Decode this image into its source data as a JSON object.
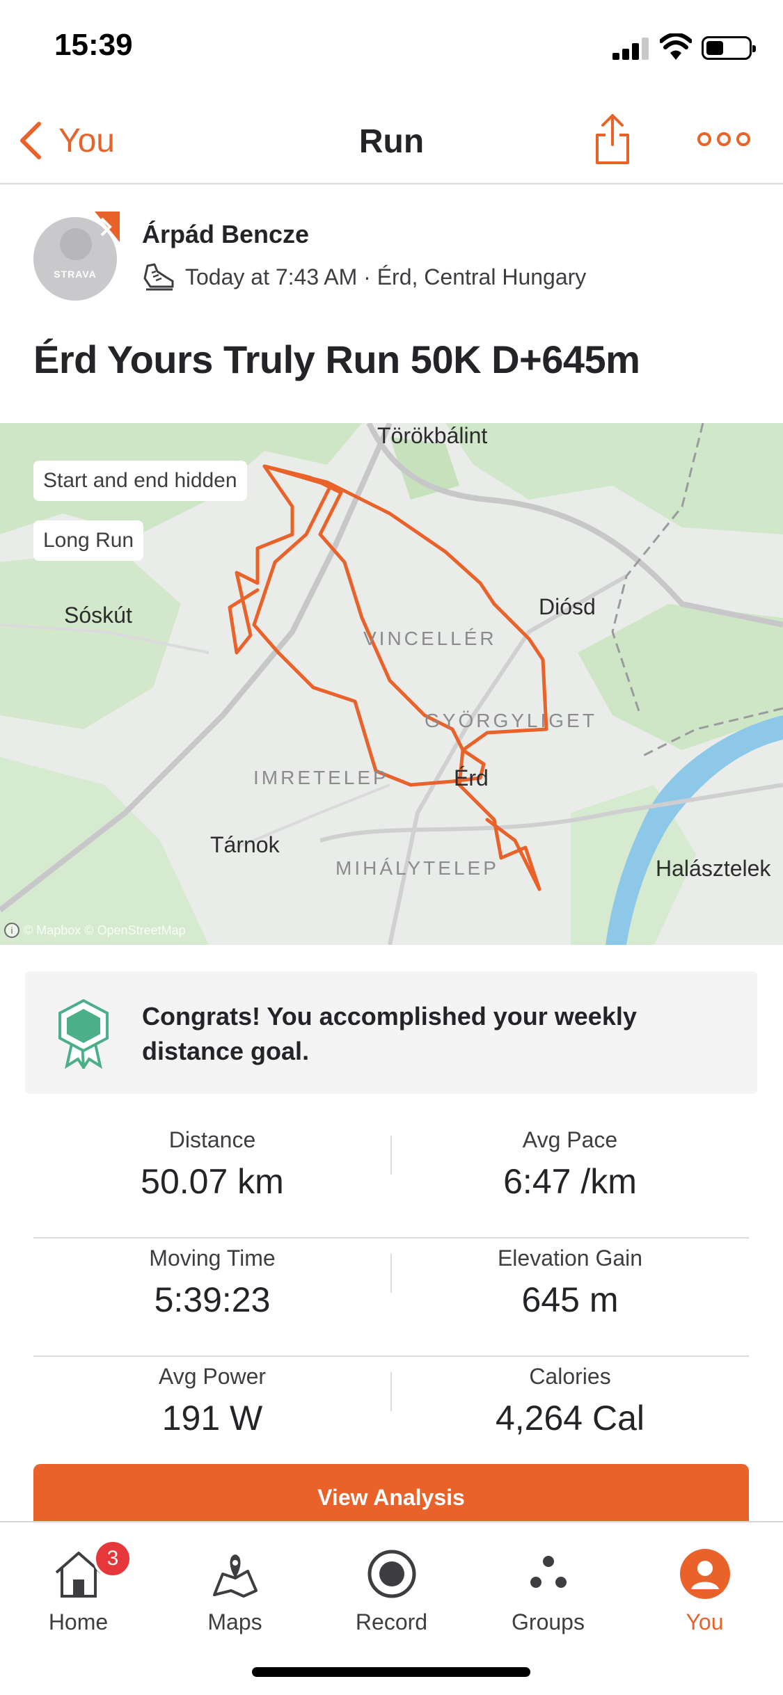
{
  "status_bar": {
    "time": "15:39"
  },
  "nav": {
    "back_label": "You",
    "title": "Run"
  },
  "athlete": {
    "name": "Árpád Bencze",
    "avatar_brand": "STRAVA",
    "meta": "Today at 7:43 AM · Érd, Central Hungary"
  },
  "activity": {
    "title": "Érd Yours Truly Run 50K D+645m"
  },
  "map": {
    "chips": {
      "hidden": "Start and end hidden",
      "tag": "Long Run"
    },
    "places": {
      "torokbalint": "Törökbálint",
      "diosd": "Diósd",
      "soskut": "Sóskút",
      "vincelle": "VINCELLÉR",
      "gyorgyliget": "GYÖRGYLIGET",
      "imretelep": "IMRETELEP",
      "erd": "Érd",
      "tarnok": "Tárnok",
      "mihalytelep": "MIHÁLYTELEP",
      "halasztelek": "Halásztelek"
    },
    "attribution": "© Mapbox © OpenStreetMap",
    "route_color": "#e8622a"
  },
  "goal": {
    "text": "Congrats! You accomplished your weekly distance goal."
  },
  "stats": {
    "distance": {
      "label": "Distance",
      "value": "50.07 km"
    },
    "pace": {
      "label": "Avg Pace",
      "value": "6:47 /km"
    },
    "moving_time": {
      "label": "Moving Time",
      "value": "5:39:23"
    },
    "elevation": {
      "label": "Elevation Gain",
      "value": "645 m"
    },
    "power": {
      "label": "Avg Power",
      "value": "191 W"
    },
    "calories": {
      "label": "Calories",
      "value": "4,264 Cal"
    }
  },
  "analysis_button": "View Analysis",
  "tabs": {
    "home": "Home",
    "home_badge": "3",
    "maps": "Maps",
    "record": "Record",
    "groups": "Groups",
    "you": "You"
  },
  "colors": {
    "accent": "#e8622a",
    "badge": "#e6383a",
    "goal_icon": "#4bb08a"
  }
}
